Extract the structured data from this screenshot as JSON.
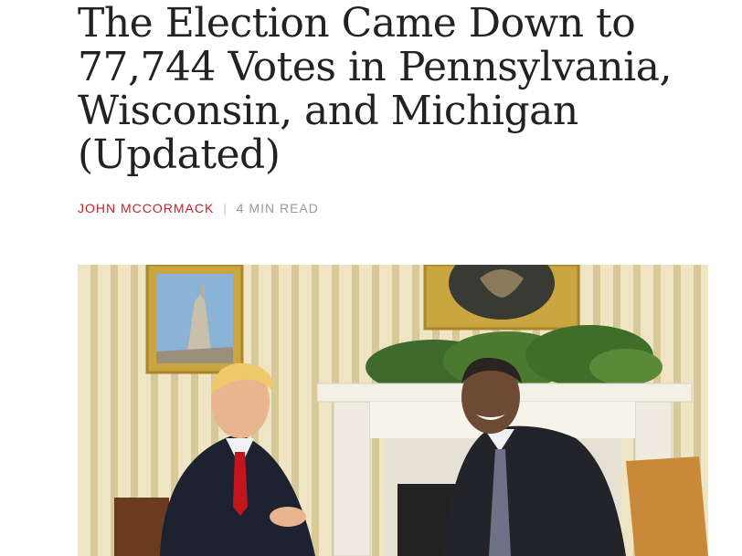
{
  "article": {
    "headline": "The Election Came Down to 77,744 Votes in Pennsylvania, Wisconsin, and Michigan (Updated)",
    "author": "JOHN MCCORMACK",
    "separator": "|",
    "read_time": "4 MIN READ"
  },
  "photo": {
    "icons": [
      "oval-office-photo"
    ]
  },
  "colors": {
    "headline": "#222222",
    "author": "#c8202f",
    "meta": "#999999"
  }
}
